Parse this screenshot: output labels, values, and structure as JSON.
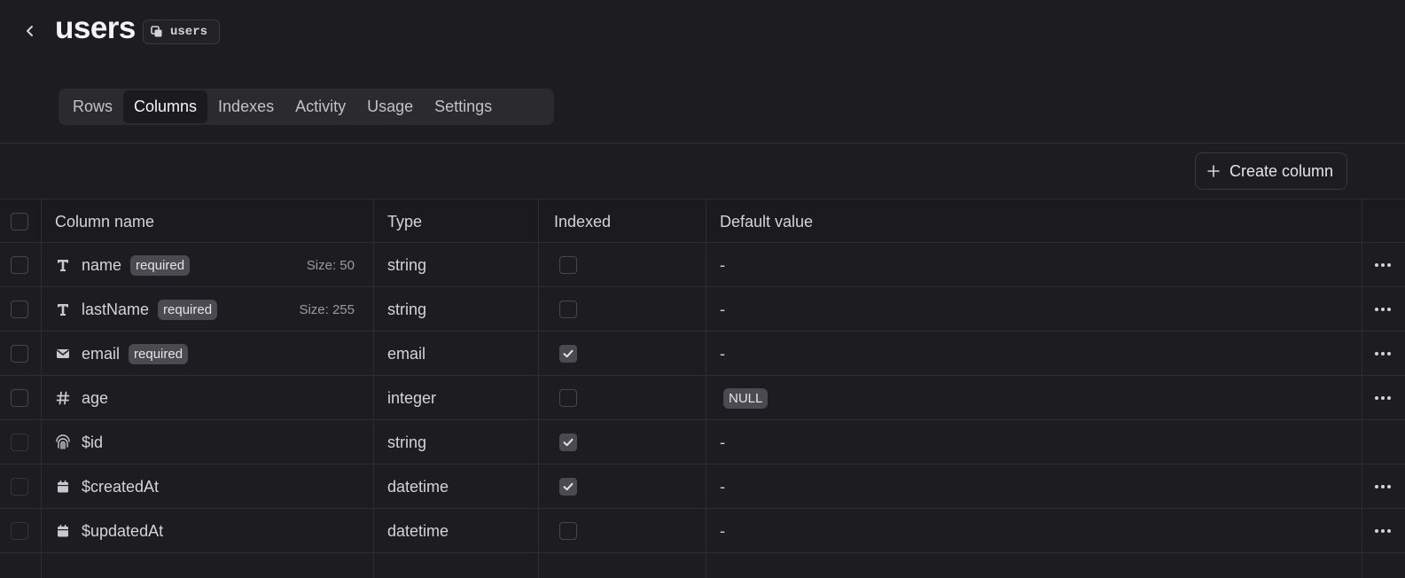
{
  "header": {
    "title": "users",
    "id_label": "users"
  },
  "tabs": [
    {
      "label": "Rows",
      "active": false
    },
    {
      "label": "Columns",
      "active": true
    },
    {
      "label": "Indexes",
      "active": false
    },
    {
      "label": "Activity",
      "active": false
    },
    {
      "label": "Usage",
      "active": false
    },
    {
      "label": "Settings",
      "active": false
    }
  ],
  "toolbar": {
    "create_label": "Create column"
  },
  "table": {
    "headers": {
      "name": "Column name",
      "type": "Type",
      "indexed": "Indexed",
      "default": "Default value"
    },
    "rows": [
      {
        "icon": "text-icon",
        "name": "name",
        "required": "required",
        "size": "Size: 50",
        "type": "string",
        "indexed": false,
        "default": "-",
        "default_is_null": false,
        "has_menu": true,
        "system": false
      },
      {
        "icon": "text-icon",
        "name": "lastName",
        "required": "required",
        "size": "Size: 255",
        "type": "string",
        "indexed": false,
        "default": "-",
        "default_is_null": false,
        "has_menu": true,
        "system": false
      },
      {
        "icon": "envelope-icon",
        "name": "email",
        "required": "required",
        "size": "",
        "type": "email",
        "indexed": true,
        "default": "-",
        "default_is_null": false,
        "has_menu": true,
        "system": false
      },
      {
        "icon": "hash-icon",
        "name": "age",
        "required": "",
        "size": "",
        "type": "integer",
        "indexed": false,
        "default": "NULL",
        "default_is_null": true,
        "has_menu": true,
        "system": false
      },
      {
        "icon": "fingerprint-icon",
        "name": "$id",
        "required": "",
        "size": "",
        "type": "string",
        "indexed": true,
        "default": "-",
        "default_is_null": false,
        "has_menu": false,
        "system": true
      },
      {
        "icon": "calendar-icon",
        "name": "$createdAt",
        "required": "",
        "size": "",
        "type": "datetime",
        "indexed": true,
        "default": "-",
        "default_is_null": false,
        "has_menu": true,
        "system": true
      },
      {
        "icon": "calendar-icon",
        "name": "$updatedAt",
        "required": "",
        "size": "",
        "type": "datetime",
        "indexed": false,
        "default": "-",
        "default_is_null": false,
        "has_menu": true,
        "system": true
      }
    ]
  }
}
